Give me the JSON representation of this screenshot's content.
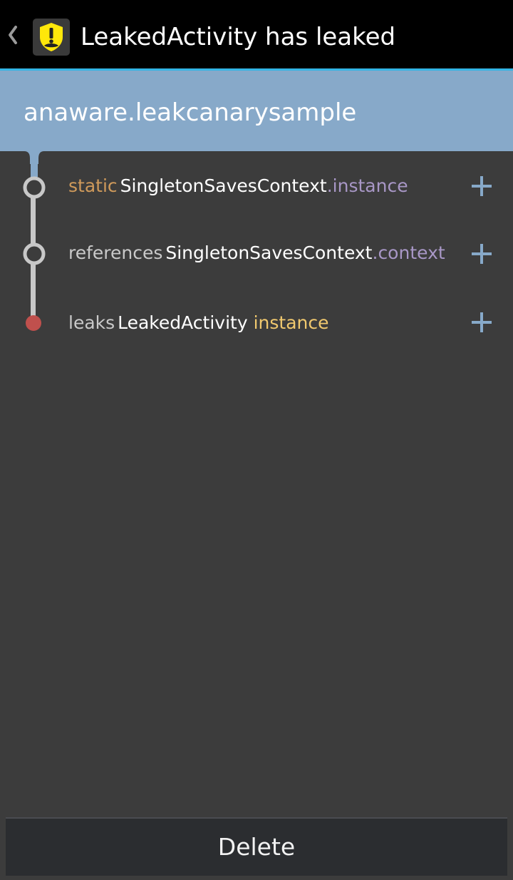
{
  "action_bar": {
    "title": "LeakedActivity has leaked",
    "back_icon": "chevron-left-icon",
    "app_icon": "leakcanary-shield-icon",
    "app_icon_color": "#ffe70a"
  },
  "header": {
    "package_name": "anaware.leakcanarysample",
    "background_color": "#87a9c9"
  },
  "trace": {
    "rows": [
      {
        "prefix": "static",
        "class_name": "SingletonSavesContext",
        "separator": ".",
        "field": "instance",
        "expand_icon": "plus-icon"
      },
      {
        "prefix": "references",
        "class_name": "SingletonSavesContext",
        "separator": ".",
        "field": "context",
        "expand_icon": "plus-icon"
      },
      {
        "prefix": "leaks",
        "class_name": "LeakedActivity",
        "separator": " ",
        "field": "instance",
        "expand_icon": "plus-icon"
      }
    ]
  },
  "footer": {
    "delete_label": "Delete"
  },
  "colors": {
    "accent_blue": "#33b5e5",
    "leak_red": "#c0504d",
    "background": "#3c3c3c"
  }
}
